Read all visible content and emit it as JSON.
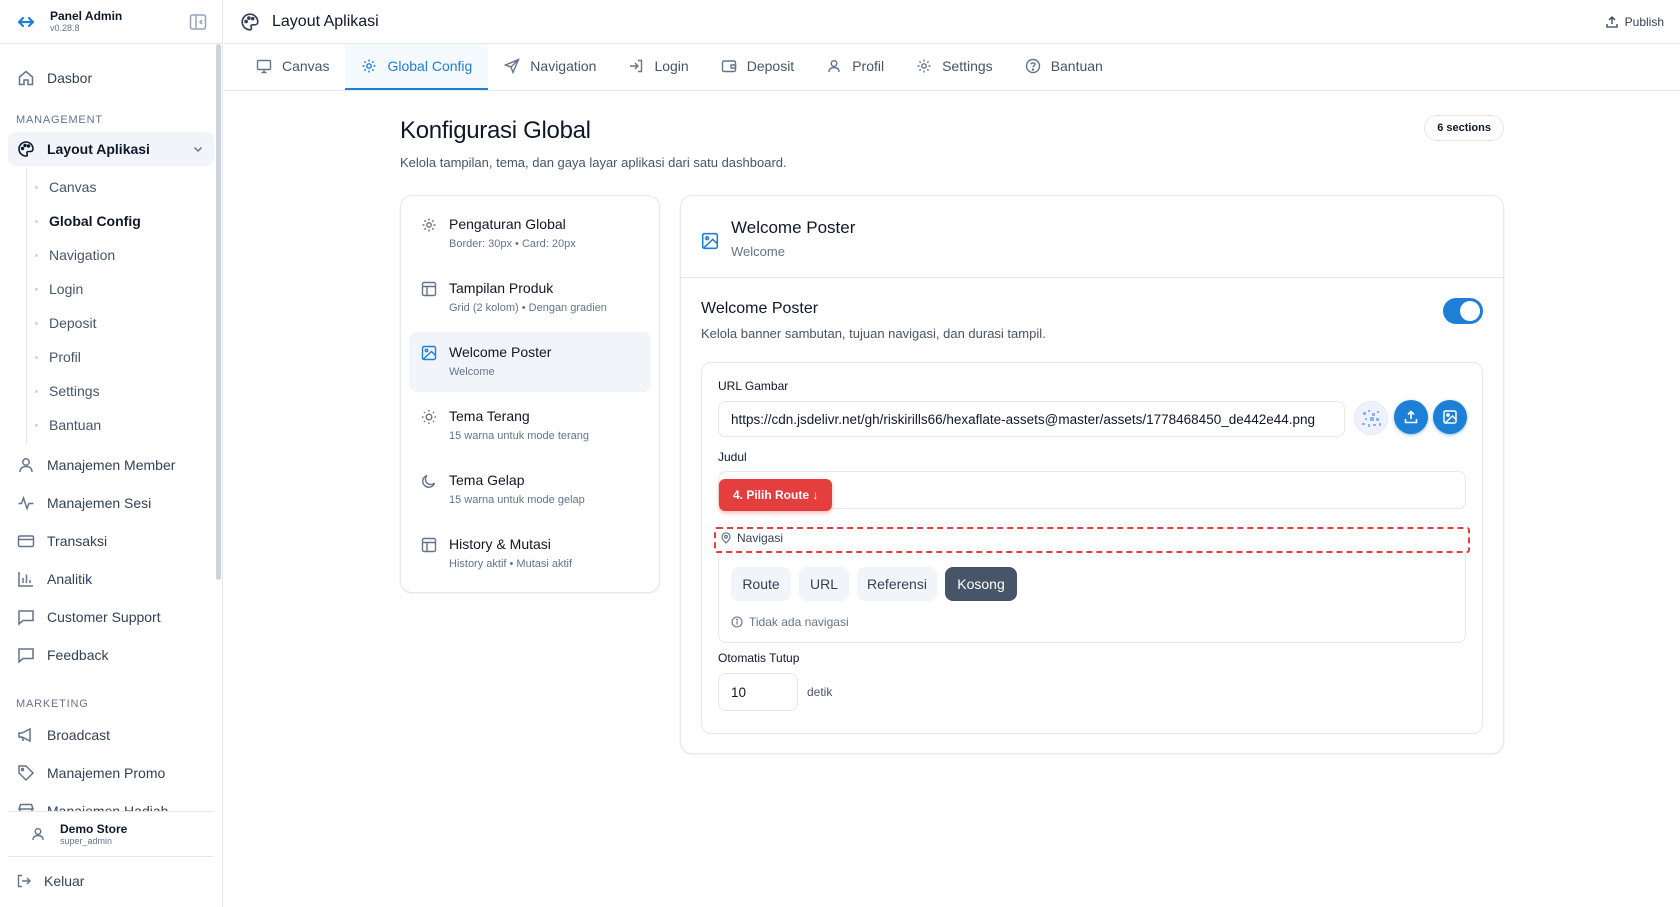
{
  "app": {
    "name": "Panel Admin",
    "version": "v0.28.8"
  },
  "sidebar": {
    "home": "Dasbor",
    "section_management": "MANAGEMENT",
    "layout_group": "Layout Aplikasi",
    "layout_sub": [
      "Canvas",
      "Global Config",
      "Navigation",
      "Login",
      "Deposit",
      "Profil",
      "Settings",
      "Bantuan"
    ],
    "management_items": [
      "Manajemen Member",
      "Manajemen Sesi",
      "Transaksi",
      "Analitik",
      "Customer Support",
      "Feedback"
    ],
    "section_marketing": "MARKETING",
    "marketing_items": [
      "Broadcast",
      "Manajemen Promo",
      "Manajemen Hadiah"
    ]
  },
  "user": {
    "name": "Demo Store",
    "role": "super_admin",
    "logout": "Keluar"
  },
  "topbar": {
    "title": "Layout Aplikasi",
    "publish": "Publish"
  },
  "tabs": [
    "Canvas",
    "Global Config",
    "Navigation",
    "Login",
    "Deposit",
    "Profil",
    "Settings",
    "Bantuan"
  ],
  "page": {
    "title": "Konfigurasi Global",
    "subtitle": "Kelola tampilan, tema, dan gaya layar aplikasi dari satu dashboard.",
    "count": "6 sections"
  },
  "sections": [
    {
      "title": "Pengaturan Global",
      "desc": "Border: 30px • Card: 20px"
    },
    {
      "title": "Tampilan Produk",
      "desc": "Grid (2 kolom) • Dengan gradien"
    },
    {
      "title": "Welcome Poster",
      "desc": "Welcome"
    },
    {
      "title": "Tema Terang",
      "desc": "15 warna untuk mode terang"
    },
    {
      "title": "Tema Gelap",
      "desc": "15 warna untuk mode gelap"
    },
    {
      "title": "History & Mutasi",
      "desc": "History aktif • Mutasi aktif"
    }
  ],
  "detail": {
    "title": "Welcome Poster",
    "subtitle": "Welcome",
    "toggle_title": "Welcome Poster",
    "toggle_desc": "Kelola banner sambutan, tujuan navigasi, dan durasi tampil.",
    "toggle_on": true,
    "url_label": "URL Gambar",
    "url_value": "https://cdn.jsdelivr.net/gh/riskirills66/hexaflate-assets@master/assets/1778468450_de442e44.png",
    "judul_label": "Judul",
    "judul_value": "",
    "tour_badge": "4. Pilih Route ↓",
    "nav_label": "Navigasi",
    "nav_options": [
      "Route",
      "URL",
      "Referensi",
      "Kosong"
    ],
    "nav_selected": "Kosong",
    "nav_empty": "Tidak ada navigasi",
    "auto_close_label": "Otomatis Tutup",
    "auto_close_value": "10",
    "auto_close_unit": "detik"
  },
  "colors": {
    "accent": "#1d7fd6",
    "danger": "#e53e3e",
    "selected_segment": "#475569"
  }
}
